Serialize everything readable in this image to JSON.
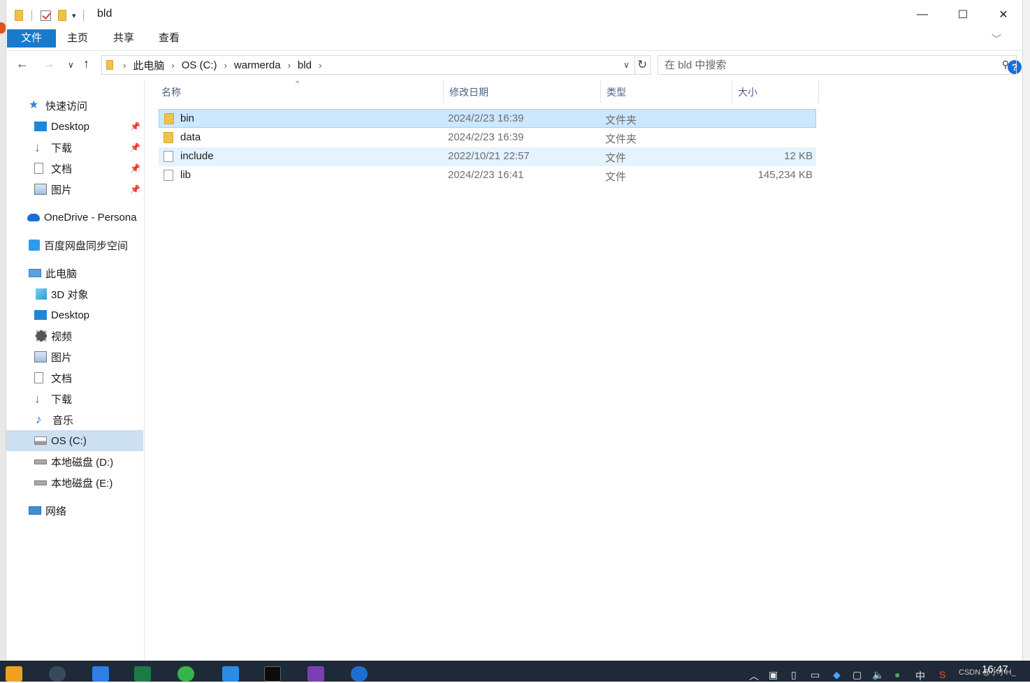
{
  "window": {
    "title": "bld",
    "minimize": "—",
    "maximize": "☐",
    "close": "✕"
  },
  "ribbon": {
    "file": "文件",
    "home": "主页",
    "share": "共享",
    "view": "查看",
    "help": "?"
  },
  "address": {
    "crumbs": [
      "此电脑",
      "OS (C:)",
      "warmerda",
      "bld"
    ]
  },
  "search": {
    "placeholder": "在 bld 中搜索"
  },
  "nav": {
    "quick_access": "快速访问",
    "qa_items": [
      "Desktop",
      "下载",
      "文档",
      "图片"
    ],
    "onedrive": "OneDrive - Persona",
    "baidu": "百度网盘同步空间",
    "this_pc": "此电脑",
    "pc_items": [
      "3D 对象",
      "Desktop",
      "视频",
      "图片",
      "文档",
      "下载",
      "音乐",
      "OS (C:)",
      "本地磁盘 (D:)",
      "本地磁盘 (E:)"
    ],
    "network": "网络"
  },
  "columns": {
    "name": "名称",
    "modified": "修改日期",
    "type": "类型",
    "size": "大小"
  },
  "files": [
    {
      "name": "bin",
      "modified": "2024/2/23 16:39",
      "type": "文件夹",
      "size": "",
      "kind": "folder"
    },
    {
      "name": "data",
      "modified": "2024/2/23 16:39",
      "type": "文件夹",
      "size": "",
      "kind": "folder"
    },
    {
      "name": "include",
      "modified": "2022/10/21 22:57",
      "type": "文件",
      "size": "12 KB",
      "kind": "file"
    },
    {
      "name": "lib",
      "modified": "2024/2/23 16:41",
      "type": "文件",
      "size": "145,234 KB",
      "kind": "file"
    }
  ],
  "taskbar": {
    "clock": "16:47",
    "ime": "中",
    "csdn": "CSDN @小小H_"
  },
  "colors": {
    "accent": "#1979ca",
    "selection": "#cce8ff",
    "taskbar": "#1f2a38"
  }
}
